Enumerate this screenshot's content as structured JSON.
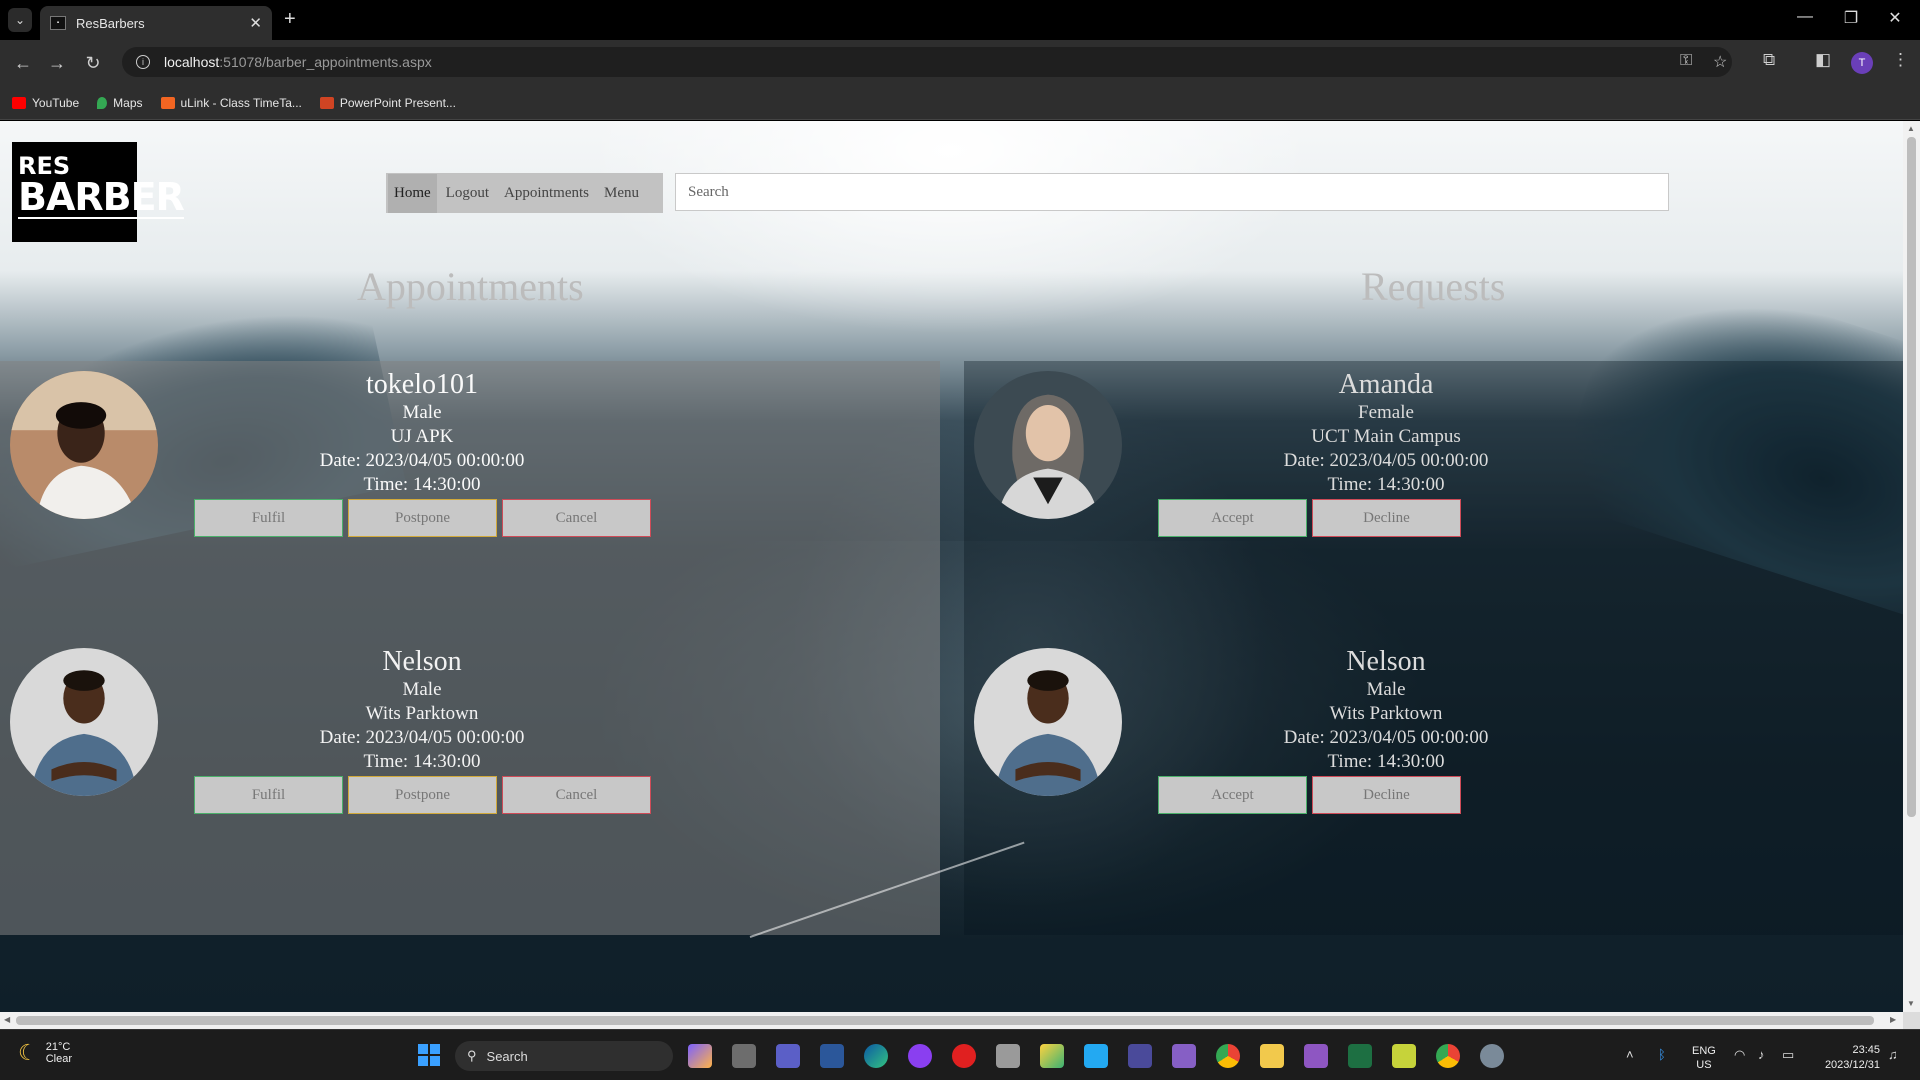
{
  "browser": {
    "tab_title": "ResBarbers",
    "url_host": "localhost",
    "url_rest": ":51078/barber_appointments.aspx",
    "new_tab_glyph": "+",
    "close_glyph": "✕",
    "bookmarks": [
      {
        "label": "YouTube",
        "color": "#ff0000"
      },
      {
        "label": "Maps",
        "color": "#34a853"
      },
      {
        "label": "uLink - Class TimeTa...",
        "color": "#f26522"
      },
      {
        "label": "PowerPoint Present...",
        "color": "#d04423"
      }
    ]
  },
  "page": {
    "logo_line1": "RES",
    "logo_line2": "BARBER",
    "nav": {
      "home": "Home",
      "logout": "Logout",
      "appointments": "Appointments",
      "menu": "Menu"
    },
    "search_placeholder": "Search",
    "appointments_title": "Appointments",
    "requests_title": "Requests",
    "appointments": [
      {
        "name": "tokelo101",
        "gender": "Male",
        "campus": "UJ APK",
        "date": "Date: 2023/04/05 00:00:00",
        "time": "Time: 14:30:00"
      },
      {
        "name": "Nelson",
        "gender": "Male",
        "campus": "Wits Parktown",
        "date": "Date: 2023/04/05 00:00:00",
        "time": "Time: 14:30:00"
      }
    ],
    "requests": [
      {
        "name": "Amanda",
        "gender": "Female",
        "campus": "UCT Main Campus",
        "date": "Date: 2023/04/05 00:00:00",
        "time": "Time: 14:30:00"
      },
      {
        "name": "Nelson",
        "gender": "Male",
        "campus": "Wits Parktown",
        "date": "Date: 2023/04/05 00:00:00",
        "time": "Time: 14:30:00"
      }
    ],
    "buttons": {
      "fulfil": "Fulfil",
      "postpone": "Postpone",
      "cancel": "Cancel",
      "accept": "Accept",
      "decline": "Decline"
    }
  },
  "taskbar": {
    "temperature": "21°C",
    "condition": "Clear",
    "search_label": "Search",
    "lang_line1": "ENG",
    "lang_line2": "US",
    "time": "23:45",
    "date": "2023/12/31"
  }
}
